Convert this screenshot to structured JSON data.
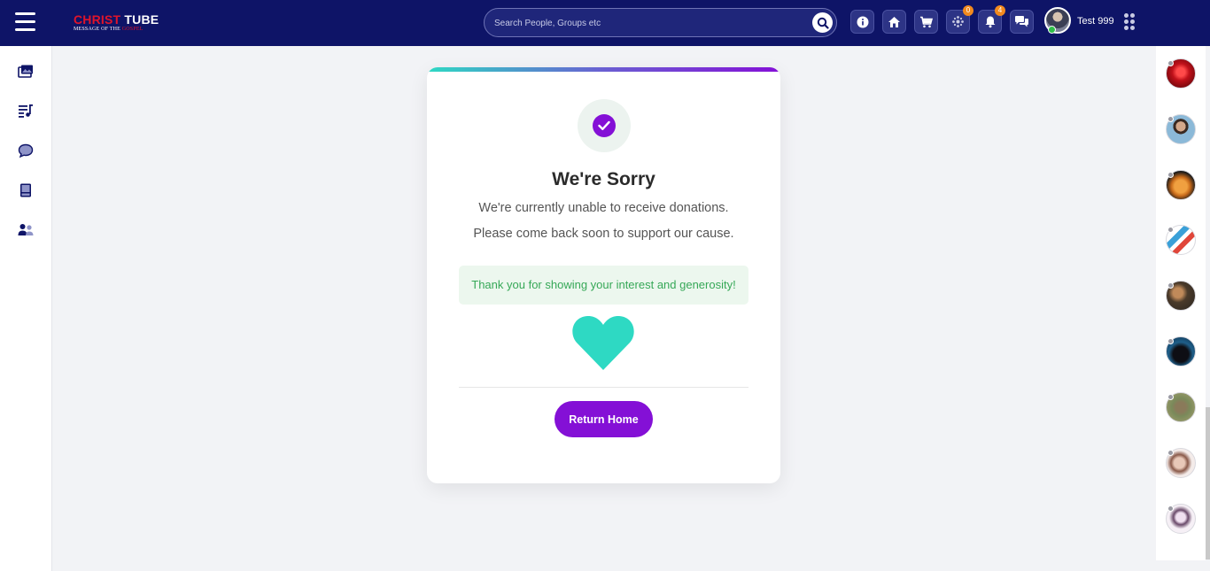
{
  "header": {
    "logo": {
      "word1": "CHRIST",
      "word2": "TUBE",
      "tagline_a": "MESSAGE OF THE ",
      "tagline_b": "GOSPEL"
    },
    "search": {
      "placeholder": "Search People, Groups etc"
    },
    "icons": [
      {
        "name": "info-icon"
      },
      {
        "name": "home-icon"
      },
      {
        "name": "cart-icon"
      },
      {
        "name": "friends-icon",
        "badge": "0"
      },
      {
        "name": "bell-icon",
        "badge": "4"
      },
      {
        "name": "messages-icon"
      }
    ],
    "user": {
      "name": "Test 999"
    }
  },
  "sidebar_left": [
    {
      "name": "gallery-icon"
    },
    {
      "name": "playlist-icon"
    },
    {
      "name": "chat-icon"
    },
    {
      "name": "tablet-icon"
    },
    {
      "name": "users-icon"
    }
  ],
  "card": {
    "title": "We're Sorry",
    "line1": "We're currently unable to receive donations.",
    "line2": "Please come back soon to support our cause.",
    "thanks": "Thank you for showing your interest and generosity!",
    "button": "Return Home"
  },
  "colors": {
    "topbar": "#0e1467",
    "accent": "#8410d6",
    "heart": "#2ed9c3",
    "thanks_bg": "#ecf7ee",
    "thanks_text": "#36a857",
    "badge": "#f28a1e"
  }
}
